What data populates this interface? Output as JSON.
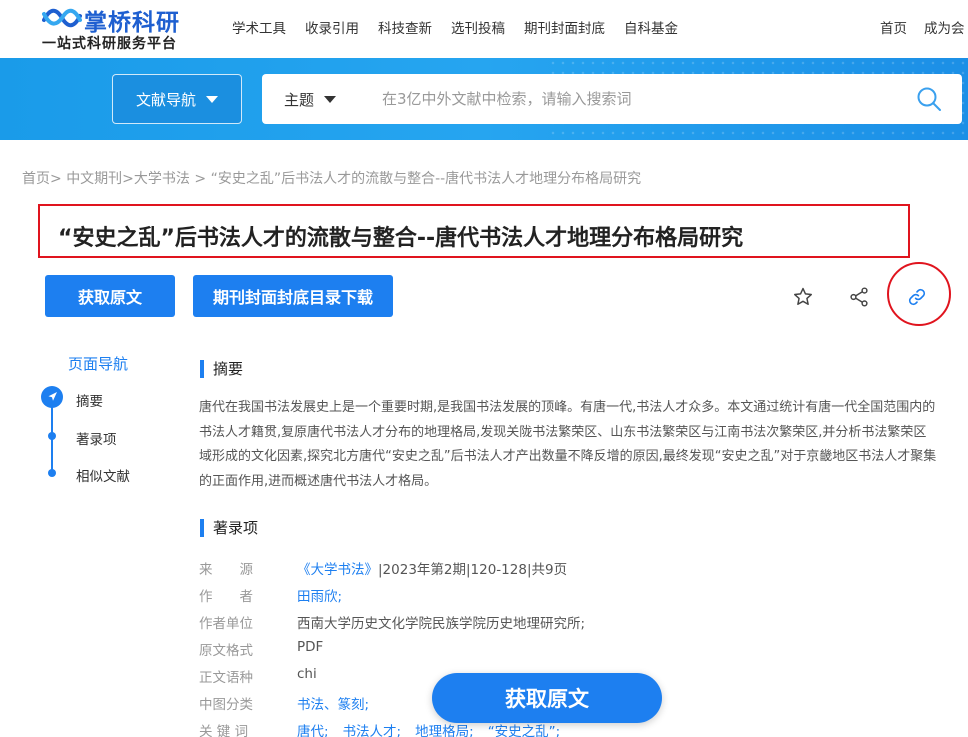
{
  "brand": {
    "name": "掌桥科研",
    "tagline": "一站式科研服务平台",
    "color": "#1e5fd0"
  },
  "nav": {
    "items": [
      "学术工具",
      "收录引用",
      "科技查新",
      "选刊投稿",
      "期刊封面封底",
      "自科基金"
    ],
    "right": [
      "首页",
      "成为会"
    ]
  },
  "search": {
    "doc_nav_label": "文献导航",
    "scope": "主题",
    "placeholder": "在3亿中外文献中检索，请输入搜索词"
  },
  "breadcrumb": [
    "首页>",
    "中文期刊>",
    "大学书法 >",
    "“安史之乱”后书法人才的流散与整合--唐代书法人才地理分布格局研究"
  ],
  "article": {
    "title": "“安史之乱”后书法人才的流散与整合--唐代书法人才地理分布格局研究",
    "get_fulltext": "获取原文",
    "cover_download": "期刊封面封底目录下载"
  },
  "page_nav": {
    "title": "页面导航",
    "items": [
      "摘要",
      "著录项",
      "相似文献"
    ]
  },
  "sections": {
    "abstract_title": "摘要",
    "abstract_text": "唐代在我国书法发展史上是一个重要时期,是我国书法发展的顶峰。有唐一代,书法人才众多。本文通过统计有唐一代全国范围内的书法人才籍贯,复原唐代书法人才分布的地理格局,发现关陇书法繁荣区、山东书法繁荣区与江南书法次繁荣区,并分析书法繁荣区域形成的文化因素,探究北方唐代“安史之乱”后书法人才产出数量不降反增的原因,最终发现“安史之乱”对于京畿地区书法人才聚集的正面作用,进而概述唐代书法人才格局。",
    "record_title": "著录项"
  },
  "record": {
    "source": {
      "key": "来　　源",
      "journal": "《大学书法》",
      "rest": "|2023年第2期|120-128|共9页"
    },
    "author": {
      "key": "作　　者",
      "value": "田雨欣;"
    },
    "affiliation": {
      "key": "作者单位",
      "value": "西南大学历史文化学院民族学院历史地理研究所;"
    },
    "format": {
      "key": "原文格式",
      "value": "PDF"
    },
    "language": {
      "key": "正文语种",
      "value": "chi"
    },
    "clc": {
      "key": "中图分类",
      "values": [
        "书法、篆刻;"
      ]
    },
    "keywords": {
      "key": "关 键 词",
      "values": [
        "唐代;",
        "书法人才;",
        "地理格局;",
        "“安史之乱”;"
      ]
    }
  },
  "floating_cta": "获取原文",
  "colors": {
    "accent": "#1d7ff0",
    "band": "#1a9be9",
    "highlight": "#e0141e"
  }
}
